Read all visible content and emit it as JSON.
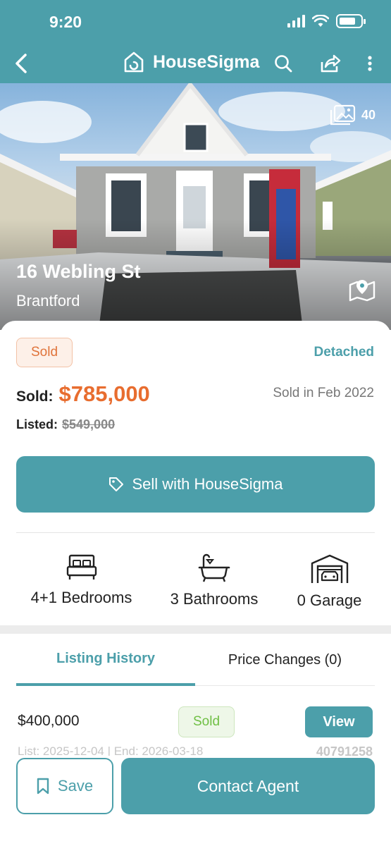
{
  "status_bar": {
    "time": "9:20"
  },
  "header": {
    "brand": "HouseSigma",
    "icons": [
      "back-chevron-icon",
      "housesigma-logo-icon",
      "search-icon",
      "share-icon",
      "more-vert-icon"
    ]
  },
  "hero": {
    "photo_count": "40",
    "address": "16 Webling St",
    "city": "Brantford",
    "map_icon": "map-pin-icon"
  },
  "listing": {
    "status_badge": "Sold",
    "property_type": "Detached",
    "sold_label": "Sold:",
    "sold_price": "$785,000",
    "sold_date": "Sold in Feb 2022",
    "listed_label": "Listed:",
    "listed_price": "$549,000"
  },
  "sell_button": {
    "label": "Sell with HouseSigma",
    "icon": "tag-icon"
  },
  "features": [
    {
      "label": "4+1 Bedrooms",
      "icon": "bed-icon"
    },
    {
      "label": "3 Bathrooms",
      "icon": "bathtub-icon"
    },
    {
      "label": "0 Garage",
      "icon": "garage-icon"
    }
  ],
  "tabs": [
    {
      "label": "Listing History",
      "active": true
    },
    {
      "label": "Price Changes (0)",
      "active": false
    }
  ],
  "history": [
    {
      "price": "$400,000",
      "status": "Sold",
      "action": "View",
      "dates": "List: 2025-12-04 | End: 2026-03-18",
      "mls": "40791258"
    }
  ],
  "bottom_bar": {
    "save_label": "Save",
    "contact_label": "Contact Agent"
  },
  "colors": {
    "primary": "#4c9faa",
    "price": "#e86d2f",
    "sold_badge": "#e0733a",
    "sold_green": "#6fbf44"
  }
}
